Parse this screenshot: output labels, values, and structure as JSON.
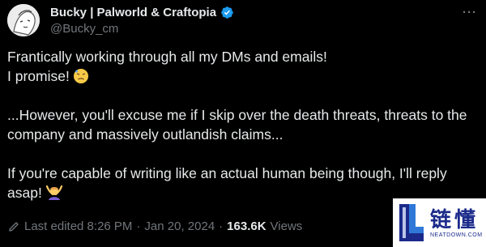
{
  "author": {
    "display_name": "Bucky | Palworld & Craftopia",
    "handle": "@Bucky_cm"
  },
  "tweet": {
    "paragraphs": [
      {
        "lines": [
          "Frantically working through all my DMs and emails!",
          "I promise!"
        ]
      },
      {
        "lines": [
          "...However, you'll excuse me if I skip over the death threats, threats to the",
          "company and massively outlandish claims..."
        ]
      },
      {
        "lines": [
          "If you're capable of writing like an actual human being though, I'll reply",
          "asap!"
        ]
      }
    ],
    "emojis": [
      "downcast-face-with-sweat-emoji",
      "person-gesturing-ok-emoji"
    ]
  },
  "meta": {
    "edited": "Last edited 8:26 PM",
    "date": "Jan 20, 2024",
    "separator": "·",
    "views_count": "163.6K",
    "views_label": "Views"
  },
  "watermark": {
    "brand_cn": "链懂",
    "url": "NEATDOWN.COM"
  },
  "colors": {
    "background": "#000000",
    "text": "#e7e9ea",
    "muted": "#71767b",
    "verified": "#1d9bf0",
    "watermark_brand": "#1b2a8a"
  }
}
